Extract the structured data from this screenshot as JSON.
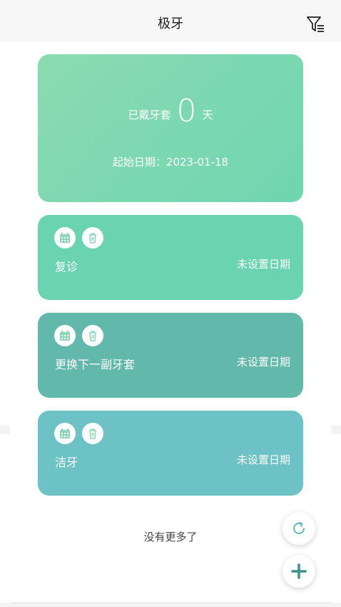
{
  "header": {
    "title": "极牙",
    "filter_icon": "filter-list-icon"
  },
  "summary": {
    "worn_prefix": "已戴牙套",
    "worn_days": "0",
    "worn_suffix": "天",
    "start_date_label": "起始日期：",
    "start_date_value": "2023-01-18",
    "color": "#7fd8b0"
  },
  "tasks": [
    {
      "name": "复诊",
      "date_text": "未设置日期",
      "color": "#6ad3b0"
    },
    {
      "name": "更换下一副牙套",
      "date_text": "未设置日期",
      "color": "#62b8aa"
    },
    {
      "name": "洁牙",
      "date_text": "未设置日期",
      "color": "#6cc2c4"
    }
  ],
  "task_icons": {
    "calendar": "calendar-icon",
    "delete": "trash-icon"
  },
  "footer": {
    "no_more": "没有更多了"
  },
  "fabs": {
    "refresh": "refresh-icon",
    "add": "plus-icon"
  }
}
